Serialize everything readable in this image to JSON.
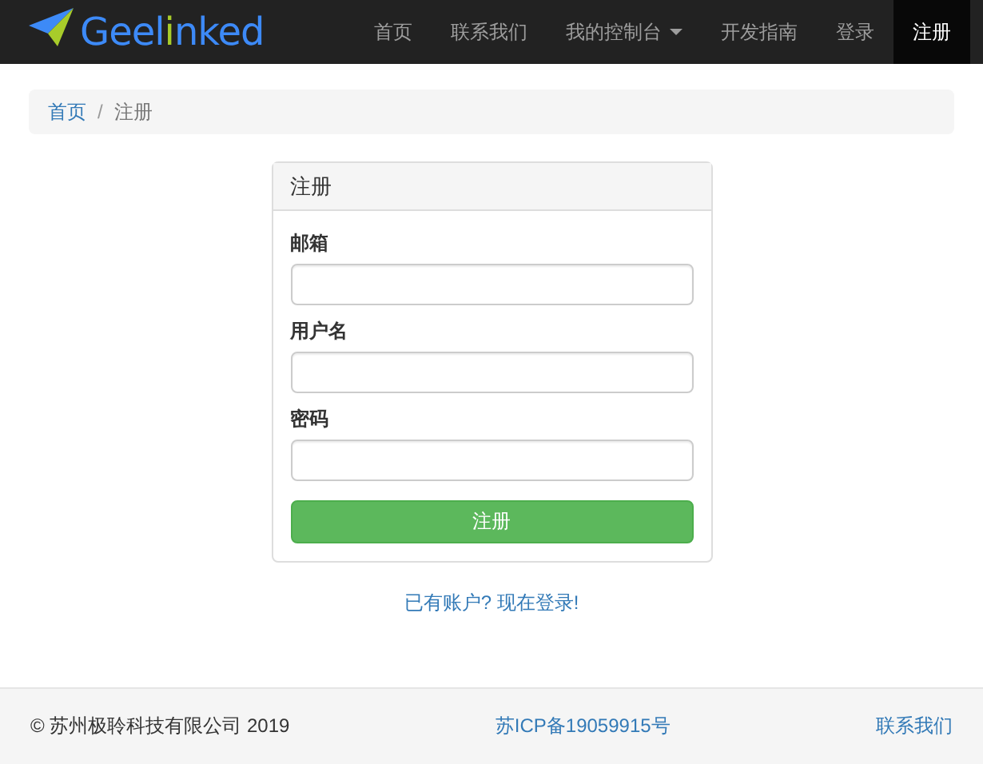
{
  "logo": {
    "parts": [
      {
        "text": "Geel",
        "color": "#3d8af7"
      },
      {
        "text": "i",
        "color": "#a8cc2a"
      },
      {
        "text": "nked",
        "color": "#3d8af7"
      }
    ]
  },
  "nav": [
    {
      "label": "首页",
      "selected": false,
      "dropdown": false
    },
    {
      "label": "联系我们",
      "selected": false,
      "dropdown": false
    },
    {
      "label": "我的控制台",
      "selected": false,
      "dropdown": true
    },
    {
      "label": "开发指南",
      "selected": false,
      "dropdown": false
    },
    {
      "label": "登录",
      "selected": false,
      "dropdown": false
    },
    {
      "label": "注册",
      "selected": true,
      "dropdown": false
    }
  ],
  "breadcrumb_separator": "/",
  "breadcrumb": [
    {
      "label": "首页",
      "kind": "link"
    },
    {
      "label": "注册",
      "kind": "current"
    }
  ],
  "panel": {
    "title": "注册",
    "fields": [
      {
        "label": "邮箱"
      },
      {
        "label": "用户名"
      },
      {
        "label": "密码"
      }
    ],
    "submit": "注册"
  },
  "login_link": "已有账户? 现在登录!",
  "footer": {
    "copyright": "© 苏州极聆科技有限公司 2019",
    "icp": "苏ICP备19059915号",
    "contact": "联系我们"
  }
}
